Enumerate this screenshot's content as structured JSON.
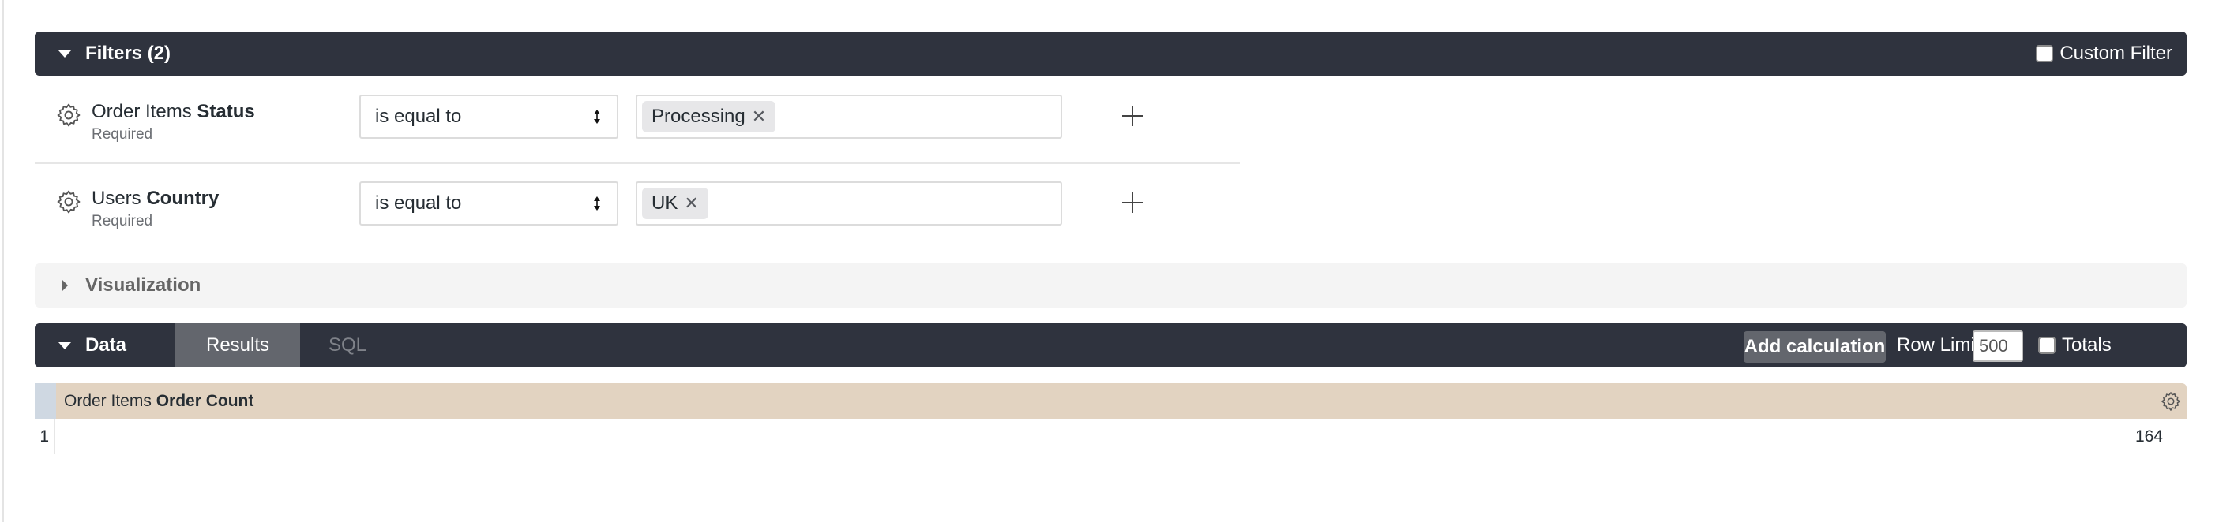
{
  "filters_section": {
    "title": "Filters (2)",
    "custom_filter_label": "Custom Filter",
    "custom_filter_checked": false,
    "filters": [
      {
        "field_view": "Order Items",
        "field_name": "Status",
        "required_label": "Required",
        "operator": "is equal to",
        "values": [
          "Processing"
        ]
      },
      {
        "field_view": "Users",
        "field_name": "Country",
        "required_label": "Required",
        "operator": "is equal to",
        "values": [
          "UK"
        ]
      }
    ],
    "remove_chip_glyph": "✕",
    "icons": {
      "field_options": "gear-icon",
      "add_value": "plus-icon",
      "select_arrows": "updown-icon"
    }
  },
  "visualization_section": {
    "title": "Visualization",
    "icon": "caret-right-icon"
  },
  "data_section": {
    "title": "Data",
    "tabs": [
      {
        "label": "Results",
        "active": true
      },
      {
        "label": "SQL",
        "active": false
      }
    ],
    "add_calculation_label": "Add calculation",
    "row_limit_label": "Row Limit",
    "row_limit_value": "500",
    "totals_label": "Totals",
    "totals_checked": false
  },
  "results": {
    "columns": [
      {
        "view": "Order Items",
        "field": "Order Count"
      }
    ],
    "rows": [
      {
        "index": "1",
        "values": [
          "164"
        ]
      }
    ],
    "column_colors": {
      "row_number_header": "#cfd8e2",
      "measure_header": "#e2d3c1"
    }
  },
  "theme": {
    "bar_bg": "#2f333e",
    "tab_active_bg": "#63666d",
    "viz_bar_bg": "#f4f4f4"
  }
}
